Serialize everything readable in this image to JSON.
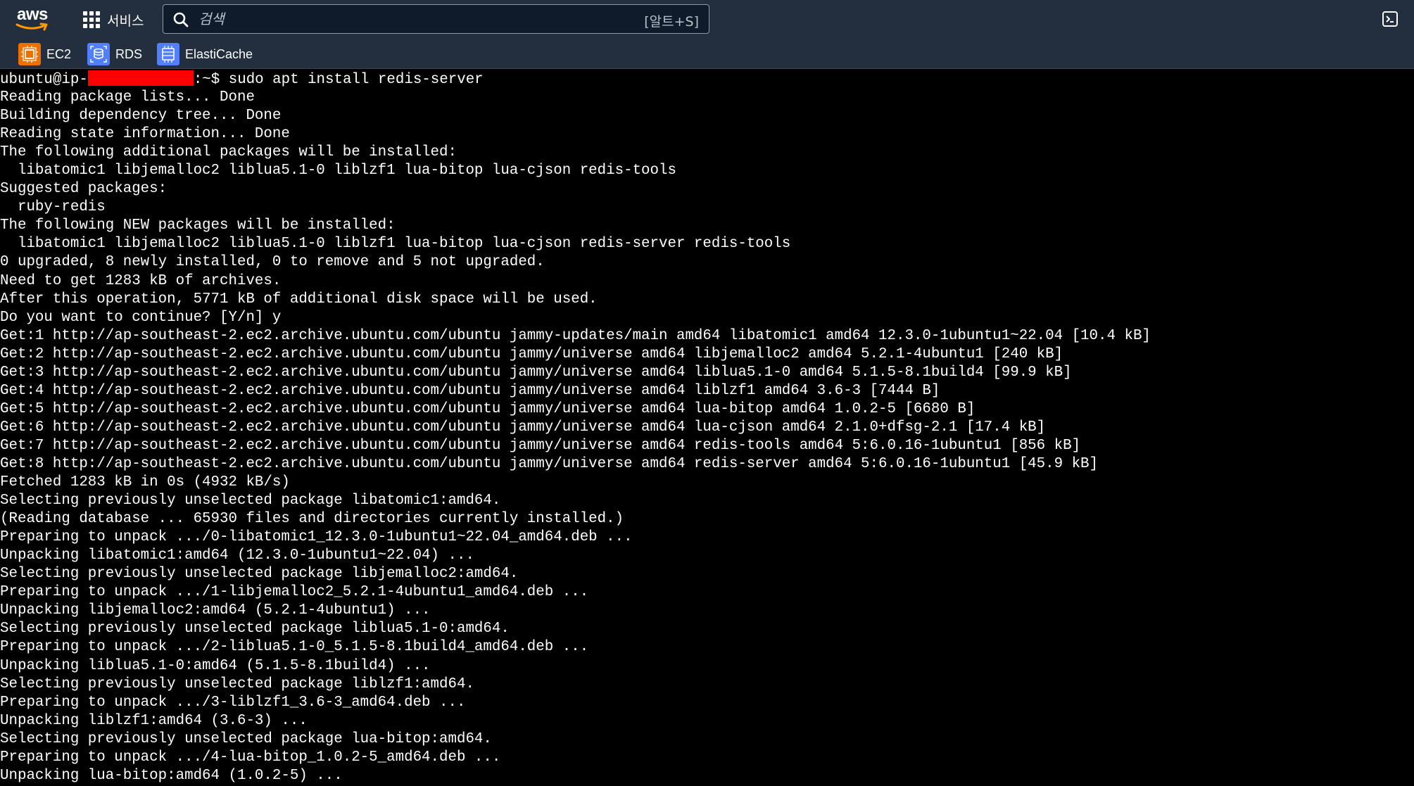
{
  "topbar": {
    "logo_text": "aws",
    "services_label": "서비스",
    "search_placeholder": "검색",
    "search_shortcut": "[알트+S]",
    "colors": {
      "background": "#232f3e",
      "logo_smile": "#ff9900"
    },
    "icons": {
      "services": "grid-icon",
      "search": "search-icon",
      "cloudshell": "cloudshell-icon"
    }
  },
  "favorites": [
    {
      "label": "EC2",
      "icon": "ec2-icon",
      "color": "#ed7100"
    },
    {
      "label": "RDS",
      "icon": "rds-icon",
      "color": "#527fff"
    },
    {
      "label": "ElastiCache",
      "icon": "elasticache-icon",
      "color": "#527fff"
    }
  ],
  "terminal": {
    "prompt_user": "ubuntu@ip-",
    "prompt_suffix": ":~$ sudo apt install redis-server",
    "lines": [
      "Reading package lists... Done",
      "Building dependency tree... Done",
      "Reading state information... Done",
      "The following additional packages will be installed:",
      "  libatomic1 libjemalloc2 liblua5.1-0 liblzf1 lua-bitop lua-cjson redis-tools",
      "Suggested packages:",
      "  ruby-redis",
      "The following NEW packages will be installed:",
      "  libatomic1 libjemalloc2 liblua5.1-0 liblzf1 lua-bitop lua-cjson redis-server redis-tools",
      "0 upgraded, 8 newly installed, 0 to remove and 5 not upgraded.",
      "Need to get 1283 kB of archives.",
      "After this operation, 5771 kB of additional disk space will be used.",
      "Do you want to continue? [Y/n] y",
      "Get:1 http://ap-southeast-2.ec2.archive.ubuntu.com/ubuntu jammy-updates/main amd64 libatomic1 amd64 12.3.0-1ubuntu1~22.04 [10.4 kB]",
      "Get:2 http://ap-southeast-2.ec2.archive.ubuntu.com/ubuntu jammy/universe amd64 libjemalloc2 amd64 5.2.1-4ubuntu1 [240 kB]",
      "Get:3 http://ap-southeast-2.ec2.archive.ubuntu.com/ubuntu jammy/universe amd64 liblua5.1-0 amd64 5.1.5-8.1build4 [99.9 kB]",
      "Get:4 http://ap-southeast-2.ec2.archive.ubuntu.com/ubuntu jammy/universe amd64 liblzf1 amd64 3.6-3 [7444 B]",
      "Get:5 http://ap-southeast-2.ec2.archive.ubuntu.com/ubuntu jammy/universe amd64 lua-bitop amd64 1.0.2-5 [6680 B]",
      "Get:6 http://ap-southeast-2.ec2.archive.ubuntu.com/ubuntu jammy/universe amd64 lua-cjson amd64 2.1.0+dfsg-2.1 [17.4 kB]",
      "Get:7 http://ap-southeast-2.ec2.archive.ubuntu.com/ubuntu jammy/universe amd64 redis-tools amd64 5:6.0.16-1ubuntu1 [856 kB]",
      "Get:8 http://ap-southeast-2.ec2.archive.ubuntu.com/ubuntu jammy/universe amd64 redis-server amd64 5:6.0.16-1ubuntu1 [45.9 kB]",
      "Fetched 1283 kB in 0s (4932 kB/s)",
      "Selecting previously unselected package libatomic1:amd64.",
      "(Reading database ... 65930 files and directories currently installed.)",
      "Preparing to unpack .../0-libatomic1_12.3.0-1ubuntu1~22.04_amd64.deb ...",
      "Unpacking libatomic1:amd64 (12.3.0-1ubuntu1~22.04) ...",
      "Selecting previously unselected package libjemalloc2:amd64.",
      "Preparing to unpack .../1-libjemalloc2_5.2.1-4ubuntu1_amd64.deb ...",
      "Unpacking libjemalloc2:amd64 (5.2.1-4ubuntu1) ...",
      "Selecting previously unselected package liblua5.1-0:amd64.",
      "Preparing to unpack .../2-liblua5.1-0_5.1.5-8.1build4_amd64.deb ...",
      "Unpacking liblua5.1-0:amd64 (5.1.5-8.1build4) ...",
      "Selecting previously unselected package liblzf1:amd64.",
      "Preparing to unpack .../3-liblzf1_3.6-3_amd64.deb ...",
      "Unpacking liblzf1:amd64 (3.6-3) ...",
      "Selecting previously unselected package lua-bitop:amd64.",
      "Preparing to unpack .../4-lua-bitop_1.0.2-5_amd64.deb ...",
      "Unpacking lua-bitop:amd64 (1.0.2-5) ..."
    ],
    "colors": {
      "background": "#000000",
      "text": "#ffffff",
      "redaction": "#ff0000"
    }
  }
}
